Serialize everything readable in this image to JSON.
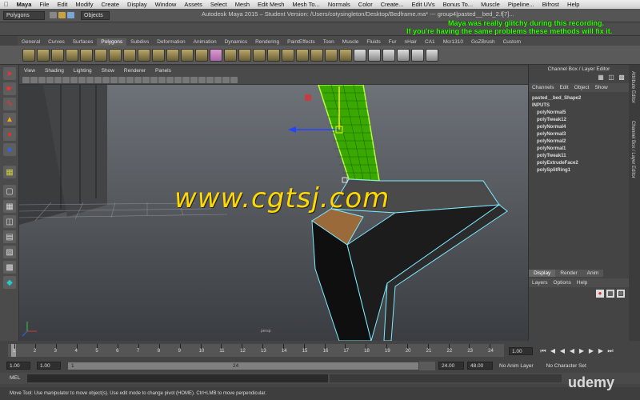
{
  "menubar": {
    "app": "Maya",
    "items": [
      "File",
      "Edit",
      "Modify",
      "Create",
      "Display",
      "Window",
      "Assets",
      "Select",
      "Mesh",
      "Edit Mesh",
      "Mesh To...",
      "Normals",
      "Color",
      "Create...",
      "Edit UVs",
      "Bonus To...",
      "Muscle",
      "Pipeline...",
      "Bifrost",
      "Help"
    ]
  },
  "statusline": {
    "menuset": "Polygons",
    "objects_label": "Objects",
    "title": "Autodesk Maya 2015 – Student Version: /Users/cotysingleton/Desktop/Bedframe.ma*   ---   group4|pasted__bed_2.f[7]..."
  },
  "notice": {
    "line1": "Maya was really glitchy during this recording.",
    "line2": "If you're having the same problems these methods will fix it."
  },
  "shelf": {
    "tabs": [
      "General",
      "Curves",
      "Surfaces",
      "Polygons",
      "Subdivs",
      "Deformation",
      "Animation",
      "Dynamics",
      "Rendering",
      "PaintEffects",
      "Toon",
      "Muscle",
      "Fluids",
      "Fur",
      "nHair",
      "CA1",
      "Mcr1310",
      "GoZBrush",
      "Custom"
    ],
    "active_tab": "Polygons"
  },
  "viewport": {
    "menu": [
      "View",
      "Shading",
      "Lighting",
      "Show",
      "Renderer",
      "Panels"
    ],
    "camera_label": "persp",
    "watermark": "www.cgtsj.com"
  },
  "channelbox": {
    "title": "Channel Box / Layer Editor",
    "menu": [
      "Channels",
      "Edit",
      "Object",
      "Show"
    ],
    "object": "pasted__bed_Shape2",
    "inputs_header": "INPUTS",
    "inputs": [
      "polyNormal5",
      "polyTweak12",
      "polyNormal4",
      "polyNormal3",
      "polyNormal2",
      "polyNormal1",
      "polyTweak11",
      "polyExtrudeFace2",
      "polySplitRing1"
    ]
  },
  "layer_editor": {
    "tabs": [
      "Display",
      "Render",
      "Anim"
    ],
    "active_tab": "Display",
    "menu": [
      "Layers",
      "Options",
      "Help"
    ]
  },
  "side_tabs": [
    "Attribute Editor",
    "Channel Box / Layer Editor"
  ],
  "timeline": {
    "ticks": [
      "1",
      "2",
      "3",
      "4",
      "5",
      "6",
      "7",
      "8",
      "9",
      "10",
      "11",
      "12",
      "13",
      "14",
      "15",
      "16",
      "17",
      "18",
      "19",
      "20",
      "21",
      "22",
      "23",
      "24"
    ],
    "current_frame": "1.00"
  },
  "range": {
    "start": "1.00",
    "start2": "1.00",
    "slider_start": "1",
    "slider_end": "24",
    "end": "24.00",
    "end2": "48.00",
    "anim_layer": "No Anim Layer",
    "character_set": "No Character Set"
  },
  "cmdline": {
    "label": "MEL"
  },
  "helpline": {
    "text": "Move Tool: Use manipulator to move object(s). Use edit mode to change pivot (HOME). Ctrl+LMB to move perpendicular."
  },
  "brand": {
    "udemy": "udemy"
  }
}
